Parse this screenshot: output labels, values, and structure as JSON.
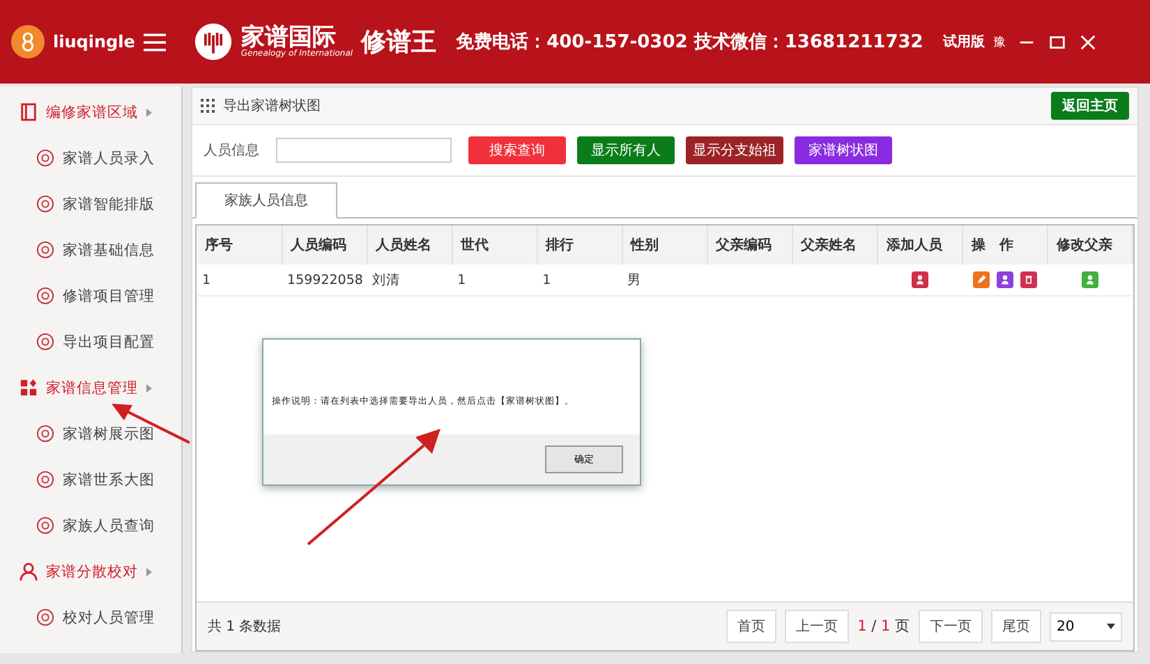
{
  "header": {
    "username": "liuqingle",
    "logo_cn": "家谱国际",
    "logo_en": "Genealogy of International",
    "product": "修谱王",
    "hotline": "免费电话：400-157-0302 技术微信：13681211732",
    "edition": "试用版",
    "edition_extra": "豫"
  },
  "sidebar": {
    "items": [
      {
        "kind": "section",
        "label": "编修家谱区域"
      },
      {
        "kind": "item",
        "label": "家谱人员录入"
      },
      {
        "kind": "item",
        "label": "家谱智能排版"
      },
      {
        "kind": "item",
        "label": "家谱基础信息"
      },
      {
        "kind": "item",
        "label": "修谱项目管理"
      },
      {
        "kind": "item",
        "label": "导出项目配置"
      },
      {
        "kind": "section",
        "label": "家谱信息管理"
      },
      {
        "kind": "item",
        "label": "家谱树展示图"
      },
      {
        "kind": "item",
        "label": "家谱世系大图"
      },
      {
        "kind": "item",
        "label": "家族人员查询"
      },
      {
        "kind": "section",
        "label": "家谱分散校对"
      },
      {
        "kind": "item",
        "label": "校对人员管理"
      }
    ]
  },
  "panel": {
    "title": "导出家谱树状图",
    "home_button": "返回主页",
    "search_label": "人员信息",
    "buttons": [
      {
        "label": "搜索查询",
        "color": "#f0303a"
      },
      {
        "label": "显示所有人",
        "color": "#0a7d1a"
      },
      {
        "label": "显示分支始祖",
        "color": "#9c2426"
      },
      {
        "label": "家谱树状图",
        "color": "#8a2be2"
      }
    ],
    "tabs": [
      {
        "label": "家族人员信息",
        "selected": true
      }
    ],
    "table": {
      "columns": [
        "序号",
        "人员编码",
        "人员姓名",
        "世代",
        "排行",
        "性别",
        "父亲编码",
        "父亲姓名",
        "添加人员",
        "操　作",
        "修改父亲"
      ],
      "rows": [
        {
          "cells": [
            "1",
            "159922058",
            "刘清",
            "1",
            "1",
            "男"
          ]
        }
      ]
    },
    "footer": {
      "total": "共 1 条数据",
      "first": "首页",
      "prev": "上一页",
      "current": "1",
      "separator": "/",
      "pages": "1",
      "pages_unit": "页",
      "next": "下一页",
      "last": "尾页",
      "page_size": "20"
    }
  },
  "dialog": {
    "message": "操作说明：请在列表中选择需要导出人员，然后点击【家谱树状图】。",
    "ok": "确定"
  }
}
